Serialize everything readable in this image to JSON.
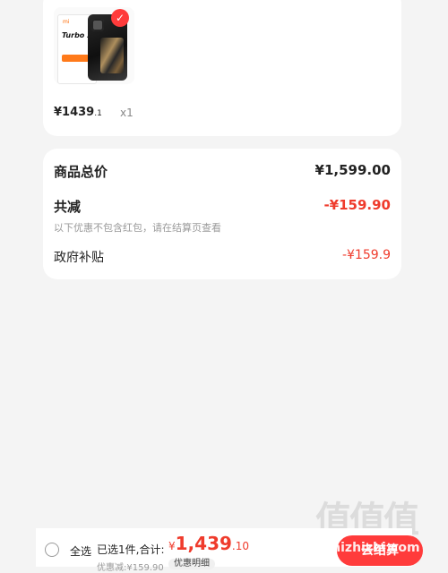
{
  "product": {
    "brand_mark": "mi",
    "box_title": "Turbo 3",
    "price_main": "¥1439",
    "price_fraction": ".1",
    "quantity": "x1",
    "selected": true
  },
  "summary": {
    "goods_total_label": "商品总价",
    "goods_total_value": "¥1,599.00",
    "total_discount_label": "共减",
    "total_discount_value": "-¥159.90",
    "discount_note": "以下优惠不包含红包，请在结算页查看",
    "subsidy_label": "政府补贴",
    "subsidy_value": "-¥159.9"
  },
  "bottom_bar": {
    "select_all_label": "全选",
    "selected_info": "已选1件,合计:",
    "total_yen": "¥",
    "total_main": "1,439",
    "total_fraction": ".10",
    "discount_line": "优惠减:¥159.90",
    "detail_label": "优惠明细",
    "checkout_label": "去结算"
  },
  "watermark": {
    "text": "值值值",
    "url": "zhizhizhi.com"
  },
  "colors": {
    "accent": "#ef3b2c",
    "checkout": "#ff3b3b",
    "background": "#f4f4f4"
  },
  "icons": [
    "check-icon",
    "radio-icon",
    "product-thumbnail"
  ]
}
